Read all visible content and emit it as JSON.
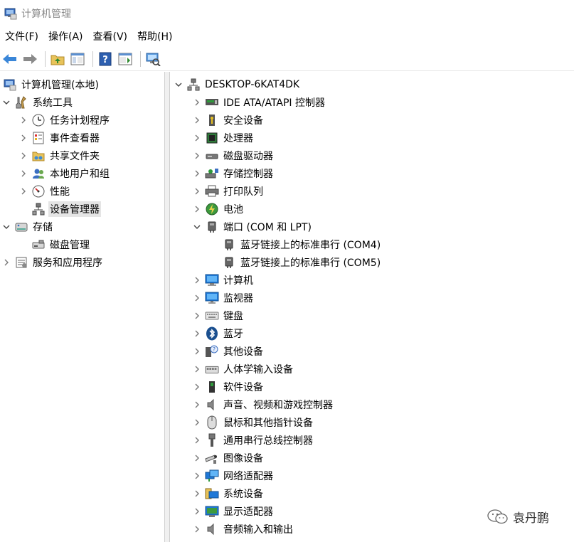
{
  "window": {
    "title": "计算机管理"
  },
  "menu": [
    "文件(F)",
    "操作(A)",
    "查看(V)",
    "帮助(H)"
  ],
  "left_tree": [
    {
      "label": "计算机管理(本地)",
      "icon": "computer-management-icon",
      "depth": 0,
      "chevron": "none"
    },
    {
      "label": "系统工具",
      "icon": "system-tools-icon",
      "depth": 0,
      "chevron": "expanded"
    },
    {
      "label": "任务计划程序",
      "icon": "task-scheduler-icon",
      "depth": 1,
      "chevron": "collapsed"
    },
    {
      "label": "事件查看器",
      "icon": "event-viewer-icon",
      "depth": 1,
      "chevron": "collapsed"
    },
    {
      "label": "共享文件夹",
      "icon": "shared-folder-icon",
      "depth": 1,
      "chevron": "collapsed"
    },
    {
      "label": "本地用户和组",
      "icon": "local-users-icon",
      "depth": 1,
      "chevron": "collapsed"
    },
    {
      "label": "性能",
      "icon": "performance-icon",
      "depth": 1,
      "chevron": "collapsed"
    },
    {
      "label": "设备管理器",
      "icon": "device-manager-icon",
      "depth": 1,
      "chevron": "none",
      "selected": true
    },
    {
      "label": "存储",
      "icon": "storage-icon",
      "depth": 0,
      "chevron": "expanded"
    },
    {
      "label": "磁盘管理",
      "icon": "disk-management-icon",
      "depth": 1,
      "chevron": "none"
    },
    {
      "label": "服务和应用程序",
      "icon": "services-icon",
      "depth": 0,
      "chevron": "collapsed"
    }
  ],
  "right_tree": {
    "root": {
      "label": "DESKTOP-6KAT4DK",
      "icon": "computer-root-icon"
    },
    "items": [
      {
        "label": "IDE ATA/ATAPI 控制器",
        "icon": "ide-controller-icon",
        "chevron": "collapsed"
      },
      {
        "label": "安全设备",
        "icon": "security-device-icon",
        "chevron": "collapsed"
      },
      {
        "label": "处理器",
        "icon": "processor-icon",
        "chevron": "collapsed"
      },
      {
        "label": "磁盘驱动器",
        "icon": "disk-drive-icon",
        "chevron": "collapsed"
      },
      {
        "label": "存储控制器",
        "icon": "storage-controller-icon",
        "chevron": "collapsed"
      },
      {
        "label": "打印队列",
        "icon": "printer-icon",
        "chevron": "collapsed"
      },
      {
        "label": "电池",
        "icon": "battery-icon",
        "chevron": "collapsed"
      },
      {
        "label": "端口 (COM 和 LPT)",
        "icon": "port-icon",
        "chevron": "expanded"
      },
      {
        "label": "蓝牙链接上的标准串行 (COM4)",
        "icon": "serial-port-icon",
        "chevron": "none",
        "child": true
      },
      {
        "label": "蓝牙链接上的标准串行 (COM5)",
        "icon": "serial-port-icon",
        "chevron": "none",
        "child": true
      },
      {
        "label": "计算机",
        "icon": "computer-icon",
        "chevron": "collapsed"
      },
      {
        "label": "监视器",
        "icon": "monitor-icon",
        "chevron": "collapsed"
      },
      {
        "label": "键盘",
        "icon": "keyboard-icon",
        "chevron": "collapsed"
      },
      {
        "label": "蓝牙",
        "icon": "bluetooth-icon",
        "chevron": "collapsed"
      },
      {
        "label": "其他设备",
        "icon": "other-devices-icon",
        "chevron": "collapsed"
      },
      {
        "label": "人体学输入设备",
        "icon": "hid-icon",
        "chevron": "collapsed"
      },
      {
        "label": "软件设备",
        "icon": "software-device-icon",
        "chevron": "collapsed"
      },
      {
        "label": "声音、视频和游戏控制器",
        "icon": "sound-icon",
        "chevron": "collapsed"
      },
      {
        "label": "鼠标和其他指针设备",
        "icon": "mouse-icon",
        "chevron": "collapsed"
      },
      {
        "label": "通用串行总线控制器",
        "icon": "usb-icon",
        "chevron": "collapsed"
      },
      {
        "label": "图像设备",
        "icon": "camera-icon",
        "chevron": "collapsed"
      },
      {
        "label": "网络适配器",
        "icon": "network-adapter-icon",
        "chevron": "collapsed"
      },
      {
        "label": "系统设备",
        "icon": "system-device-icon",
        "chevron": "collapsed"
      },
      {
        "label": "显示适配器",
        "icon": "display-adapter-icon",
        "chevron": "collapsed"
      },
      {
        "label": "音频输入和输出",
        "icon": "audio-io-icon",
        "chevron": "collapsed"
      }
    ]
  },
  "watermark": {
    "text": "袁丹鹏"
  },
  "colors": {
    "selected_bg": "#e5e5e5",
    "accent_blue": "#1e78d7"
  }
}
